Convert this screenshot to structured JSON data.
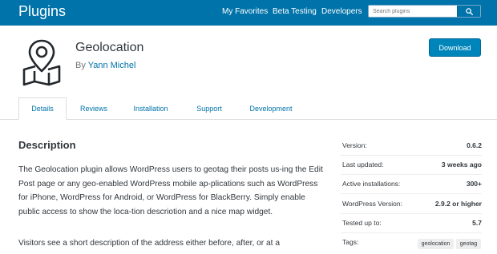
{
  "header": {
    "brand": "Plugins",
    "nav": [
      "My Favorites",
      "Beta Testing",
      "Developers"
    ],
    "search_placeholder": "Search plugins",
    "search_icon": "search-icon",
    "bg_color": "#0073aa"
  },
  "plugin": {
    "icon": "map-location-icon",
    "title": "Geolocation",
    "by_prefix": "By",
    "author": "Yann Michel",
    "download_label": "Download"
  },
  "tabs": [
    "Details",
    "Reviews",
    "Installation",
    "Support",
    "Development"
  ],
  "active_tab": "Details",
  "description": {
    "heading": "Description",
    "paragraph1": "The Geolocation plugin allows WordPress users to geotag their posts us-ing the Edit Post page or any geo-enabled WordPress mobile ap-plications such as WordPress for iPhone, WordPress for Android, or WordPress for BlackBerry. Simply enable public access to show the loca-tion descriotion and a nice map widget.",
    "paragraph2": "Visitors see a short description of the address either before, after, or at a"
  },
  "meta": [
    {
      "label": "Version:",
      "value": "0.6.2"
    },
    {
      "label": "Last updated:",
      "value": "3 weeks ago"
    },
    {
      "label": "Active installations:",
      "value": "300+"
    },
    {
      "label": "WordPress Version:",
      "value": "2.9.2 or higher"
    },
    {
      "label": "Tested up to:",
      "value": "5.7"
    },
    {
      "label": "Tags:",
      "tags": [
        "geolocation",
        "geotag"
      ]
    }
  ],
  "colors": {
    "accent": "#0073aa",
    "button": "#0085ba",
    "text": "#32373c"
  }
}
